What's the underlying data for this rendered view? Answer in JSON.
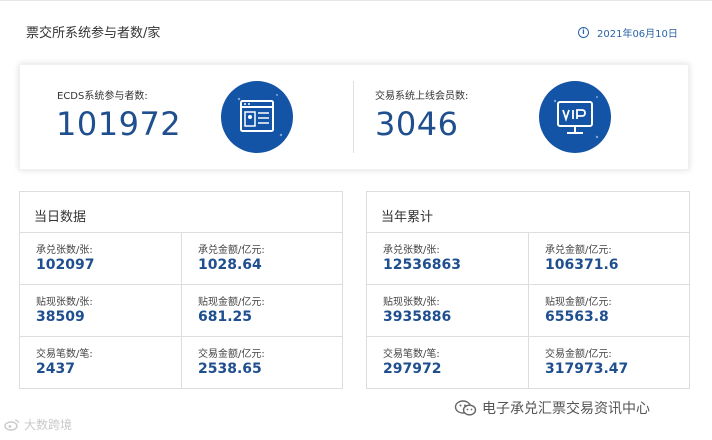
{
  "header": {
    "title": "票交所系统参与者数/家",
    "date": "2021年06月10日",
    "info_icon": "i"
  },
  "summary": {
    "left": {
      "label": "ECDS系统参与者数:",
      "value": "101972",
      "icon": "browser-user-icon"
    },
    "right": {
      "label": "交易系统上线会员数:",
      "value": "3046",
      "icon": "vip-monitor-icon"
    }
  },
  "daily": {
    "title": "当日数据",
    "cells": [
      {
        "label": "承兑张数/张:",
        "value": "102097"
      },
      {
        "label": "承兑金额/亿元:",
        "value": "1028.64"
      },
      {
        "label": "贴现张数/张:",
        "value": "38509"
      },
      {
        "label": "贴现金额/亿元:",
        "value": "681.25"
      },
      {
        "label": "交易笔数/笔:",
        "value": "2437"
      },
      {
        "label": "交易金额/亿元:",
        "value": "2538.65"
      }
    ]
  },
  "yearly": {
    "title": "当年累计",
    "cells": [
      {
        "label": "承兑张数/张:",
        "value": "12536863"
      },
      {
        "label": "承兑金额/亿元:",
        "value": "106371.6"
      },
      {
        "label": "贴现张数/张:",
        "value": "3935886"
      },
      {
        "label": "贴现金额/亿元:",
        "value": "65563.8"
      },
      {
        "label": "交易笔数/笔:",
        "value": "297972"
      },
      {
        "label": "交易金额/亿元:",
        "value": "317973.47"
      }
    ]
  },
  "watermarks": {
    "left": "大数跨境",
    "right": "电子承兑汇票交易资讯中心"
  },
  "colors": {
    "accent": "#1454a6",
    "value_text": "#1f4f8f",
    "date_text": "#2b63a8",
    "border": "#dddddd"
  }
}
